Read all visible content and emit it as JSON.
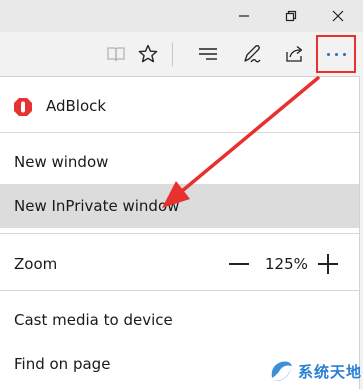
{
  "colors": {
    "highlight_box": "#e8302e",
    "dots": "#1f6fc0",
    "selected_row": "#dcdcdc",
    "arrow": "#e8302e",
    "adblock": "#e53232"
  },
  "titlebar": {
    "icons": [
      "minimize-icon",
      "maximize-icon",
      "close-icon"
    ]
  },
  "toolbar": {
    "icons": [
      "reading-view-icon",
      "favorite-star-icon",
      "hub-icon",
      "web-note-icon",
      "share-icon",
      "more-dots-icon"
    ]
  },
  "menu": {
    "adblock_label": "AdBlock",
    "new_window_label": "New window",
    "inprivate_label": "New InPrivate window",
    "zoom_label": "Zoom",
    "zoom_value": "125%",
    "cast_label": "Cast media to device",
    "find_label": "Find on page"
  },
  "watermark": {
    "text": "系统天地"
  }
}
